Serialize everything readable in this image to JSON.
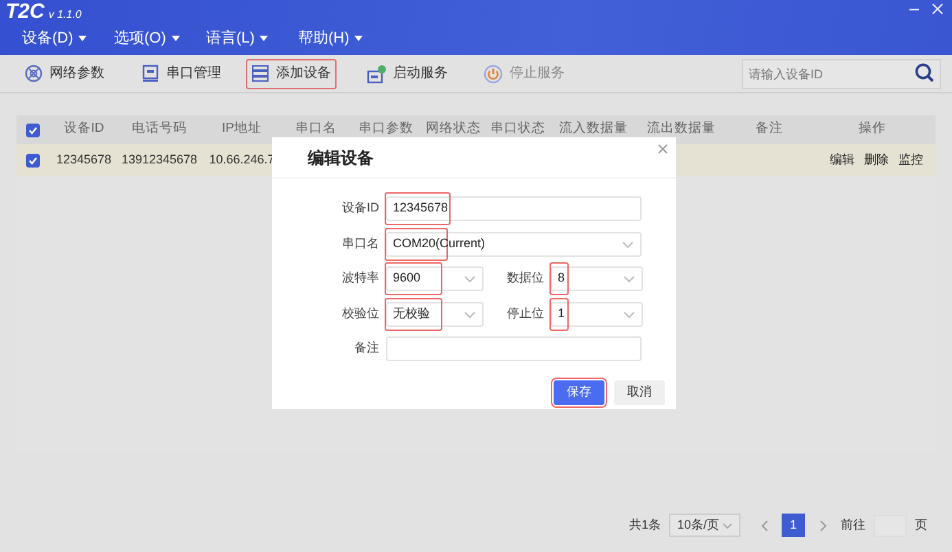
{
  "window": {
    "title": "T2C",
    "version": "v 1.1.0"
  },
  "menu": [
    {
      "label": "设备(D)"
    },
    {
      "label": "选项(O)"
    },
    {
      "label": "语言(L)"
    },
    {
      "label": "帮助(H)"
    }
  ],
  "toolbar": [
    {
      "label": "网络参数",
      "kind": "network",
      "highlighted": false,
      "disabled": false
    },
    {
      "label": "串口管理",
      "kind": "serial",
      "highlighted": false,
      "disabled": false
    },
    {
      "label": "添加设备",
      "kind": "add",
      "highlighted": true,
      "disabled": false
    },
    {
      "label": "启动服务",
      "kind": "start",
      "highlighted": false,
      "disabled": false
    },
    {
      "label": "停止服务",
      "kind": "stop",
      "highlighted": false,
      "disabled": true
    }
  ],
  "search": {
    "placeholder": "请输入设备ID"
  },
  "table": {
    "header_checked": true,
    "columns": [
      "设备ID",
      "电话号码",
      "IP地址",
      "串口名",
      "串口参数",
      "网络状态",
      "串口状态",
      "流入数据量",
      "流出数据量",
      "备注",
      "操作"
    ],
    "rows": [
      {
        "checked": true,
        "cells": [
          "12345678",
          "13912345678",
          "10.66.246.7"
        ],
        "actions": [
          "编辑",
          "删除",
          "监控"
        ]
      }
    ]
  },
  "dialog": {
    "title": "编辑设备",
    "rows": [
      [
        {
          "label": "设备ID",
          "kind": "input",
          "value": "12345678",
          "highlighted": true
        }
      ],
      [
        {
          "label": "串口名",
          "kind": "select",
          "value": "COM20(Current)",
          "highlighted": true
        }
      ],
      [
        {
          "label": "波特率",
          "kind": "select",
          "value": "9600",
          "highlighted": true
        },
        {
          "label": "数据位",
          "kind": "select",
          "value": "8",
          "highlighted": true
        }
      ],
      [
        {
          "label": "校验位",
          "kind": "select",
          "value": "无校验",
          "highlighted": true
        },
        {
          "label": "停止位",
          "kind": "select",
          "value": "1",
          "highlighted": true
        }
      ],
      [
        {
          "label": "备注",
          "kind": "input",
          "highlighted": false
        }
      ]
    ],
    "buttons": [
      {
        "label": "保存",
        "kind": "primary",
        "highlighted": true
      },
      {
        "label": "取消",
        "kind": "default",
        "highlighted": false
      }
    ]
  },
  "pagination": {
    "total": "共1条",
    "page_size": "10条/页",
    "pages": [
      {
        "label": "1",
        "selected": true
      }
    ],
    "goto_label": "前往",
    "goto_suffix": "页"
  }
}
